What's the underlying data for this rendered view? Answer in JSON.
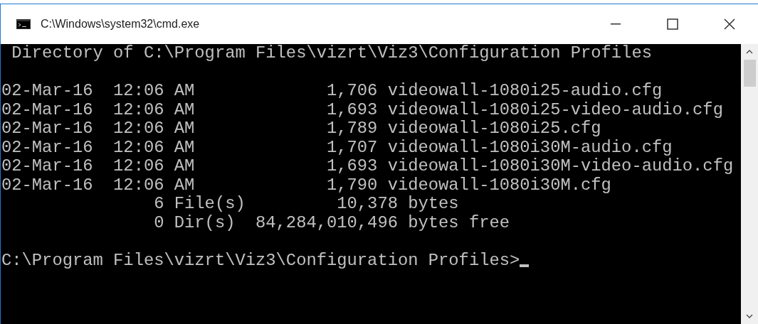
{
  "window": {
    "title": "C:\\Windows\\system32\\cmd.exe"
  },
  "console": {
    "blocks": [
      [
        " Directory of C:\\Program Files\\vizrt\\Viz3\\Configuration Profiles"
      ],
      [
        "02-Mar-16  12:06 AM             1,706 videowall-1080i25-audio.cfg",
        "02-Mar-16  12:06 AM             1,693 videowall-1080i25-video-audio.cfg",
        "02-Mar-16  12:06 AM             1,789 videowall-1080i25.cfg",
        "02-Mar-16  12:06 AM             1,707 videowall-1080i30M-audio.cfg",
        "02-Mar-16  12:06 AM             1,693 videowall-1080i30M-video-audio.cfg",
        "02-Mar-16  12:06 AM             1,790 videowall-1080i30M.cfg",
        "               6 File(s)         10,378 bytes",
        "               0 Dir(s)  84,284,010,496 bytes free"
      ],
      [
        "C:\\Program Files\\vizrt\\Viz3\\Configuration Profiles>"
      ]
    ],
    "cursor": true
  }
}
